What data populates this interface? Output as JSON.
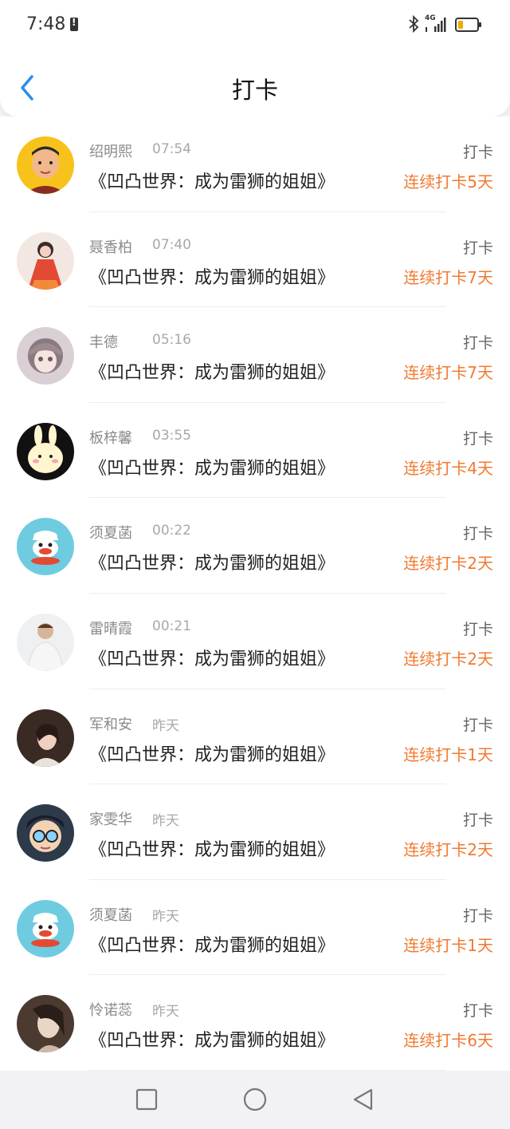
{
  "status_bar": {
    "time": "7:48",
    "network": "4G",
    "battery_level": 0.25,
    "battery_color": "#f2a900"
  },
  "header": {
    "title": "打卡"
  },
  "colors": {
    "streak": "#f07a30",
    "accent_back": "#2a8ee8"
  },
  "entries": [
    {
      "name": "绍明熙",
      "time": "07:54",
      "book": "《凹凸世界：成为雷狮的姐姐》",
      "action": "打卡",
      "streak": "连续打卡5天",
      "avatar": "cartoon-man-avatar"
    },
    {
      "name": "聂香柏",
      "time": "07:40",
      "book": "《凹凸世界：成为雷狮的姐姐》",
      "action": "打卡",
      "streak": "连续打卡7天",
      "avatar": "doll-red-dress-avatar"
    },
    {
      "name": "丰德",
      "time": "05:16",
      "book": "《凹凸世界：成为雷狮的姐姐》",
      "action": "打卡",
      "streak": "连续打卡7天",
      "avatar": "anime-girl-avatar"
    },
    {
      "name": "板梓馨",
      "time": "03:55",
      "book": "《凹凸世界：成为雷狮的姐姐》",
      "action": "打卡",
      "streak": "连续打卡4天",
      "avatar": "bunny-avatar"
    },
    {
      "name": "须夏菡",
      "time": "00:22",
      "book": "《凹凸世界：成为雷狮的姐姐》",
      "action": "打卡",
      "streak": "连续打卡2天",
      "avatar": "monkey-cartoon-avatar"
    },
    {
      "name": "雷晴霞",
      "time": "00:21",
      "book": "《凹凸世界：成为雷狮的姐姐》",
      "action": "打卡",
      "streak": "连续打卡2天",
      "avatar": "man-photo-avatar"
    },
    {
      "name": "军和安",
      "time": "昨天",
      "book": "《凹凸世界：成为雷狮的姐姐》",
      "action": "打卡",
      "streak": "连续打卡1天",
      "avatar": "woman-photo-avatar"
    },
    {
      "name": "家雯华",
      "time": "昨天",
      "book": "《凹凸世界：成为雷狮的姐姐》",
      "action": "打卡",
      "streak": "连续打卡2天",
      "avatar": "anime-boy-glasses-avatar"
    },
    {
      "name": "须夏菡",
      "time": "昨天",
      "book": "《凹凸世界：成为雷狮的姐姐》",
      "action": "打卡",
      "streak": "连续打卡1天",
      "avatar": "monkey-cartoon-avatar"
    },
    {
      "name": "怜诺蕊",
      "time": "昨天",
      "book": "《凹凸世界：成为雷狮的姐姐》",
      "action": "打卡",
      "streak": "连续打卡6天",
      "avatar": "woman-soft-photo-avatar"
    }
  ]
}
